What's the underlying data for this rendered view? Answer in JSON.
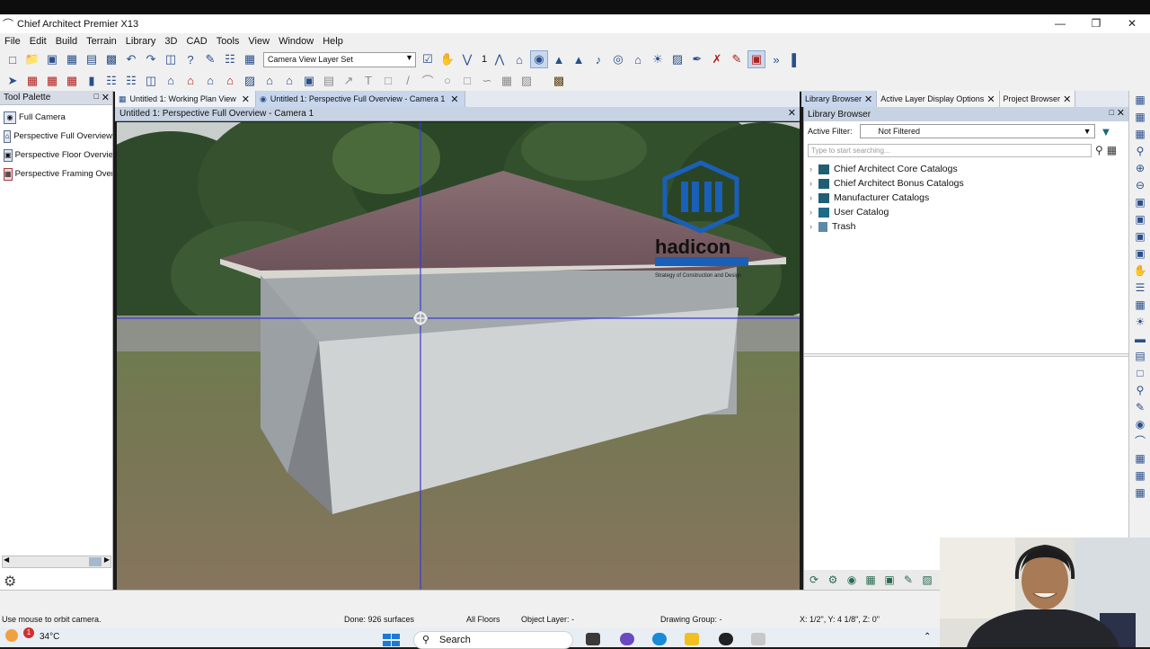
{
  "window": {
    "title": "Chief Architect Premier X13"
  },
  "menu": [
    "File",
    "Edit",
    "Build",
    "Terrain",
    "Library",
    "3D",
    "CAD",
    "Tools",
    "View",
    "Window",
    "Help"
  ],
  "toolbar": {
    "layer_set": "Camera View Layer Set",
    "floor_number": "1"
  },
  "tool_palette": {
    "title": "Tool Palette",
    "items": [
      "Full Camera",
      "Perspective Full Overview",
      "Perspective Floor Overview",
      "Perspective Framing Overvi"
    ]
  },
  "tabs": [
    {
      "label": "Untitled 1:  Working Plan View",
      "active": false
    },
    {
      "label": "Untitled 1:  Perspective Full Overview - Camera 1",
      "active": true
    }
  ],
  "view": {
    "title": "Untitled 1: Perspective Full Overview - Camera 1"
  },
  "watermark": {
    "brand": "hadicon",
    "tagline": "Strategy of Construction and Design"
  },
  "right_tabs": [
    "Library Browser",
    "Active Layer Display Options",
    "Project Browser"
  ],
  "library": {
    "title": "Library Browser",
    "filter_label": "Active Filter:",
    "filter_value": "Not Filtered",
    "search_placeholder": "Type to start searching...",
    "items": [
      "Chief Architect Core Catalogs",
      "Chief Architect Bonus Catalogs",
      "Manufacturer Catalogs",
      "User Catalog",
      "Trash"
    ]
  },
  "status": {
    "hint": "Use mouse to orbit camera.",
    "done": "Done:  926 surfaces",
    "floors": "All Floors",
    "object_layer": "Object Layer: -",
    "drawing_group": "Drawing Group: -",
    "coords": "X: 1/2\", Y: 4 1/8\", Z: 0\""
  },
  "taskbar": {
    "temperature": "34°C",
    "weather_badge": "1",
    "search_label": "Search"
  },
  "colors": {
    "accent_blue": "#1e5f74",
    "tab_active": "#c7d6ec",
    "crosshair": "#3a3ad0"
  }
}
